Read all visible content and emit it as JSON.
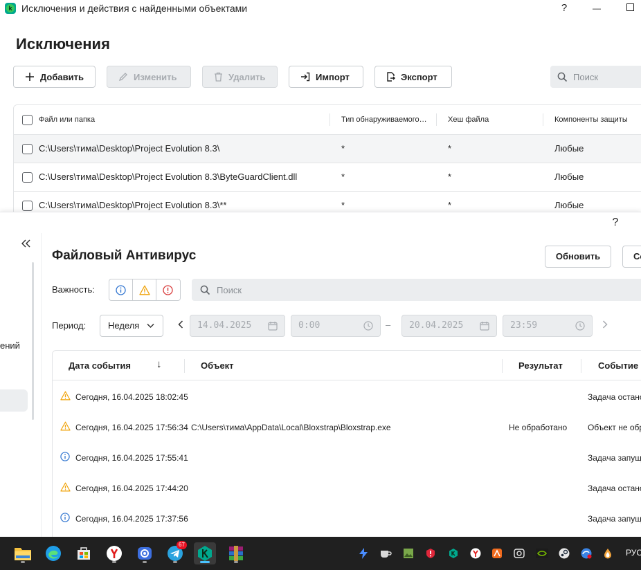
{
  "back_window": {
    "title": "Исключения и действия с найденными объектами",
    "help_glyph": "?",
    "min_glyph": "—",
    "max_glyph": "☐",
    "heading": "Исключения",
    "toolbar": {
      "add": "Добавить",
      "edit": "Изменить",
      "delete": "Удалить",
      "import": "Импорт",
      "export": "Экспорт"
    },
    "search_placeholder": "Поиск",
    "columns": [
      "Файл или папка",
      "Тип обнаруживаемого…",
      "Хеш файла",
      "Компоненты защиты"
    ],
    "rows": [
      {
        "path": "C:\\Users\\тима\\Desktop\\Project Evolution 8.3\\",
        "type": "*",
        "hash": "*",
        "components": "Любые"
      },
      {
        "path": "C:\\Users\\тима\\Desktop\\Project Evolution 8.3\\ByteGuardClient.dll",
        "type": "*",
        "hash": "*",
        "components": "Любые"
      },
      {
        "path": "C:\\Users\\тима\\Desktop\\Project Evolution 8.3\\**",
        "type": "*",
        "hash": "*",
        "components": "Любые"
      }
    ]
  },
  "front_window": {
    "help_glyph": "?",
    "collapse_glyph": "<<",
    "sidebar_fragment": "ений",
    "heading": "Файловый Антивирус",
    "refresh": "Обновить",
    "next_button_fragment": "Со",
    "severity_label": "Важность:",
    "search_placeholder": "Поиск",
    "period_label": "Период:",
    "period_value": "Неделя",
    "date_from": "14.04.2025",
    "time_from": "0:00",
    "date_sep": "–",
    "date_to": "20.04.2025",
    "time_to": "23:59",
    "prev_arrow": "<",
    "next_arrow": ">",
    "columns": {
      "date": "Дата события",
      "sort_glyph": "↓",
      "object": "Объект",
      "result": "Результат",
      "event": "Событие"
    },
    "events": [
      {
        "severity": "warning",
        "date": "Сегодня, 16.04.2025 18:02:45",
        "object": "",
        "result": "",
        "event": "Задача останов"
      },
      {
        "severity": "warning",
        "date": "Сегодня, 16.04.2025 17:56:34",
        "object": "C:\\Users\\тима\\AppData\\Local\\Bloxstrap\\Bloxstrap.exe",
        "result": "Не обработано",
        "event": "Объект не обра"
      },
      {
        "severity": "info",
        "date": "Сегодня, 16.04.2025 17:55:41",
        "object": "",
        "result": "",
        "event": "Задача запущ"
      },
      {
        "severity": "warning",
        "date": "Сегодня, 16.04.2025 17:44:20",
        "object": "",
        "result": "",
        "event": "Задача останов"
      },
      {
        "severity": "info",
        "date": "Сегодня, 16.04.2025 17:37:56",
        "object": "",
        "result": "",
        "event": "Задача запущ"
      }
    ]
  },
  "taskbar": {
    "apps": [
      "file-explorer",
      "edge",
      "store",
      "yandex-browser",
      "capture-tool",
      "telegram",
      "kaspersky",
      "winrar"
    ],
    "telegram_badge": "67",
    "language": "РУС"
  },
  "colors": {
    "warning": "#f0a30a",
    "info": "#2f74d0",
    "danger": "#d83a3a",
    "kaspersky_green": "#00a88e"
  }
}
